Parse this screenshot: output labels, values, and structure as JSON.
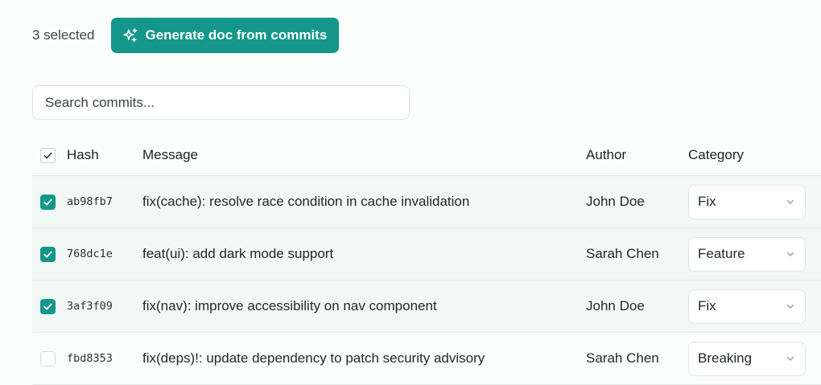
{
  "toolbar": {
    "selected_count": "3 selected",
    "generate_label": "Generate doc from commits",
    "accent": "#14978a"
  },
  "search": {
    "value": "",
    "placeholder": "Search commits..."
  },
  "table": {
    "columns": {
      "hash": "Hash",
      "message": "Message",
      "author": "Author",
      "category": "Category"
    },
    "rows": [
      {
        "checked": true,
        "hash": "ab98fb7",
        "message": "fix(cache): resolve race condition in cache invalidation",
        "author": "John Doe",
        "category": "Fix"
      },
      {
        "checked": true,
        "hash": "768dc1e",
        "message": "feat(ui): add dark mode support",
        "author": "Sarah Chen",
        "category": "Feature"
      },
      {
        "checked": true,
        "hash": "3af3f09",
        "message": "fix(nav): improve accessibility on nav component",
        "author": "John Doe",
        "category": "Fix"
      },
      {
        "checked": false,
        "hash": "fbd8353",
        "message": "fix(deps)!: update dependency to patch security advisory",
        "author": "Sarah Chen",
        "category": "Breaking"
      }
    ]
  },
  "icons": {
    "generate": "sparkles-icon",
    "select_all": "check-icon",
    "row_checked": "check-icon",
    "category_dropdown": "chevron-down-icon"
  }
}
